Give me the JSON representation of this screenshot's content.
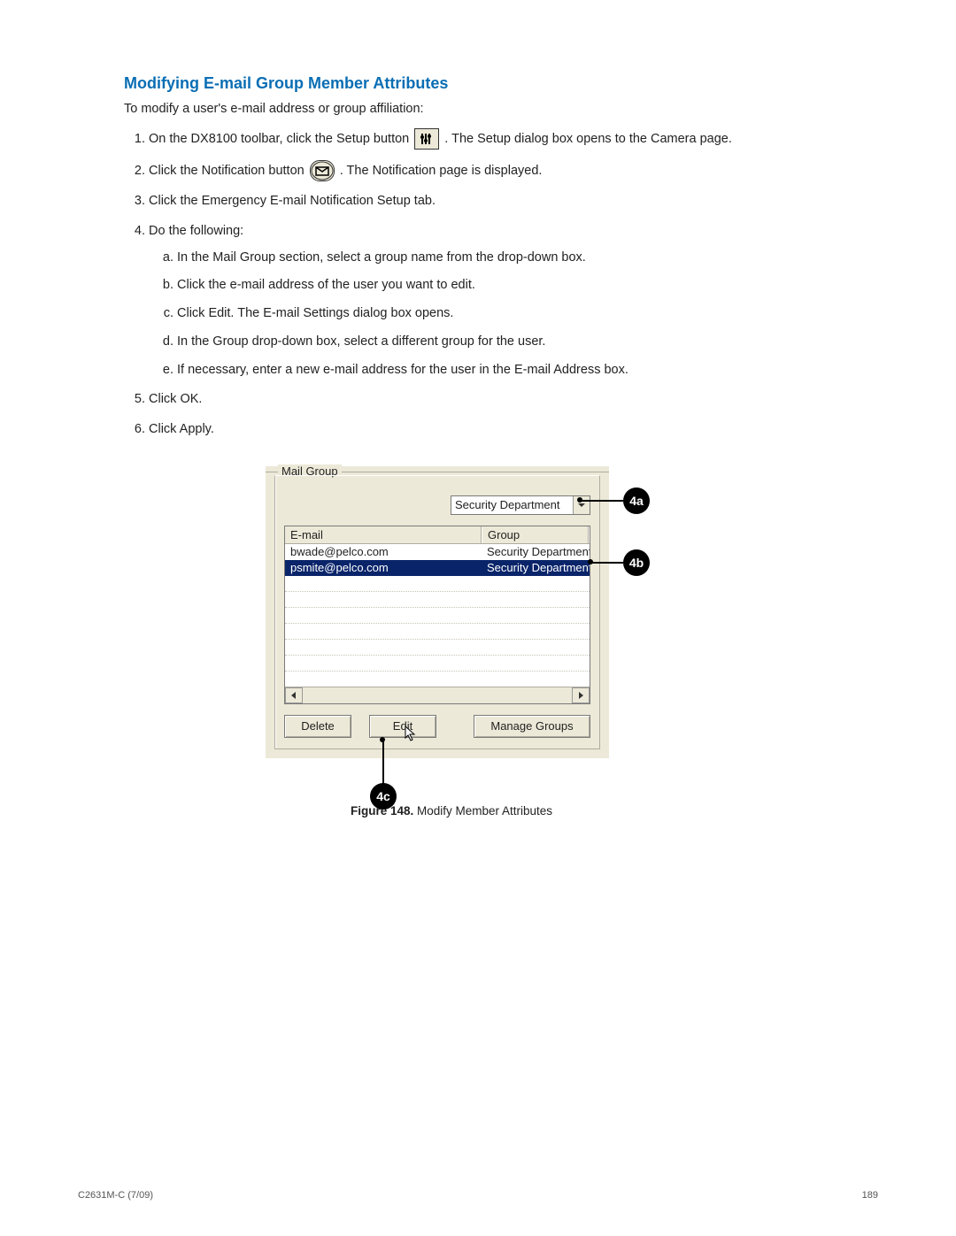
{
  "heading": "Modifying E-mail Group Member Attributes",
  "intro": "To modify a user's e-mail address or group affiliation:",
  "steps": {
    "s1_a": "On the DX8100 toolbar, click the Setup button",
    "s1_b": ". The Setup dialog box opens to the Camera page.",
    "s2_a": "Click the Notification button",
    "s2_b": ". The Notification page is displayed.",
    "s3": "Click the Emergency E-mail Notification Setup tab.",
    "s4": "Do the following:",
    "s4a": "In the Mail Group section, select a group name from the drop-down box.",
    "s4b": "Click the e-mail address of the user you want to edit.",
    "s4c": "Click Edit. The E-mail Settings dialog box opens.",
    "s4d": "In the Group drop-down box, select a different group for the user.",
    "s4e": "If necessary, enter a new e-mail address for the user in the E-mail Address box.",
    "s5": "Click OK.",
    "s6": "Click Apply."
  },
  "figure": {
    "groupbox_label": "Mail Group",
    "dropdown_value": "Security Department",
    "columns": {
      "email": "E-mail",
      "group": "Group"
    },
    "rows": [
      {
        "email": "bwade@pelco.com",
        "group": "Security Department",
        "selected": false
      },
      {
        "email": "psmite@pelco.com",
        "group": "Security Department",
        "selected": true
      }
    ],
    "buttons": {
      "delete": "Delete",
      "edit": "Edit",
      "manage": "Manage Groups"
    },
    "callouts": {
      "a": "4a",
      "b": "4b",
      "c": "4c"
    },
    "caption_label": "Figure 148.",
    "caption_text": "  Modify Member Attributes"
  },
  "footer": {
    "left": "C2631M-C (7/09)",
    "right": "189"
  }
}
